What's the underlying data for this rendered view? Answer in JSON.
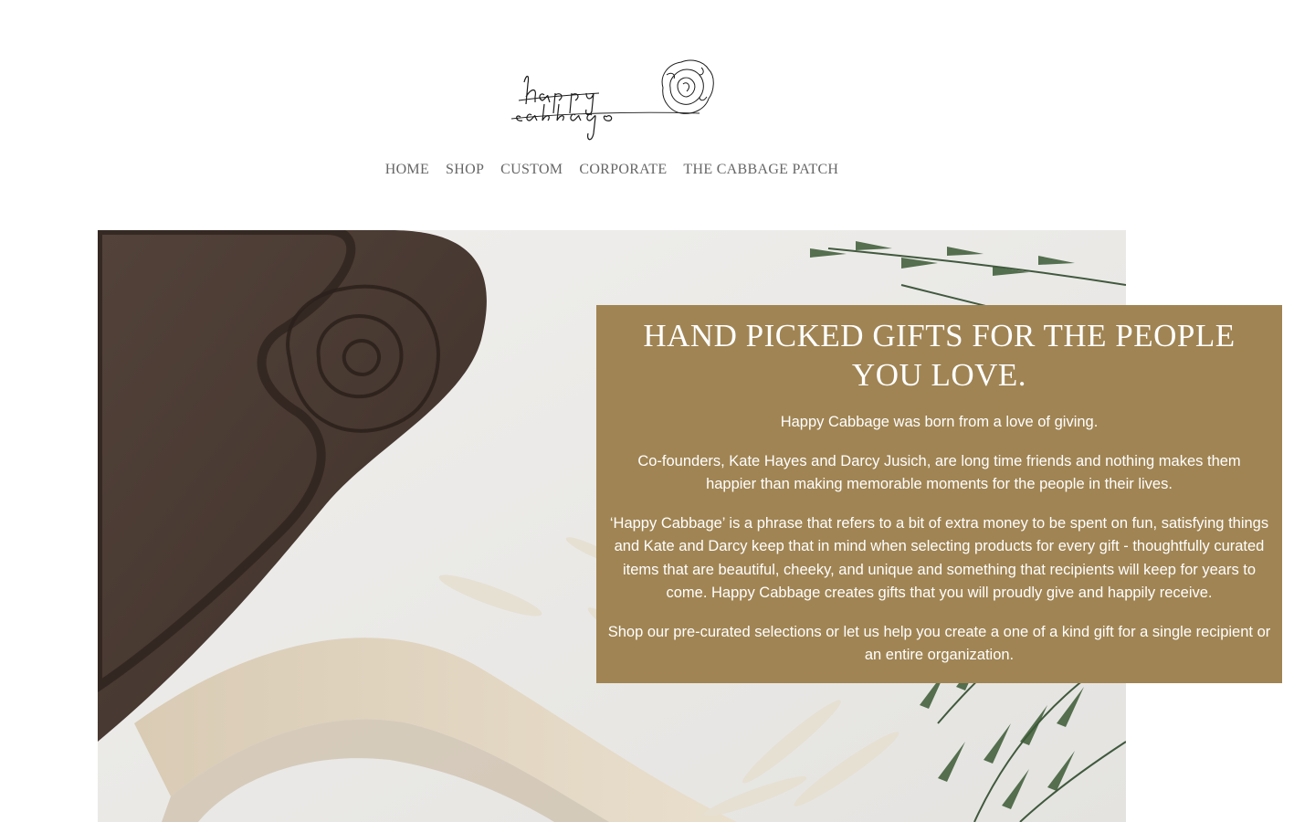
{
  "brand": {
    "logo_text": "happy cabbage"
  },
  "nav": {
    "items": [
      {
        "label": "HOME"
      },
      {
        "label": "SHOP"
      },
      {
        "label": "CUSTOM"
      },
      {
        "label": "CORPORATE"
      },
      {
        "label": "THE CABBAGE PATCH"
      }
    ]
  },
  "hero": {
    "image_alt": "",
    "headline": "HAND PICKED GIFTS FOR THE PEOPLE YOU LOVE.",
    "paragraphs": [
      "Happy Cabbage was born from a love of giving.",
      "Co-founders, Kate Hayes and Darcy Jusich, are long time friends and nothing makes them happier than making memorable moments for the people in their lives.",
      "‘Happy Cabbage’ is a phrase that refers to a bit of extra money to be spent on fun, satisfying things and Kate and Darcy keep that in mind when selecting products for every gift - thoughtfully curated items that are beautiful, cheeky, and unique and something that recipients will keep for years to come. Happy Cabbage creates gifts that you will proudly give and happily receive.",
      "Shop our pre-curated selections or let us help you create a one of a kind gift for a single recipient or an entire organization."
    ]
  },
  "colors": {
    "panel_background": "#a08453",
    "nav_text": "#666666",
    "board": "#4a3b32"
  },
  "icons": {
    "logo": "cabbage-rose-logo"
  }
}
